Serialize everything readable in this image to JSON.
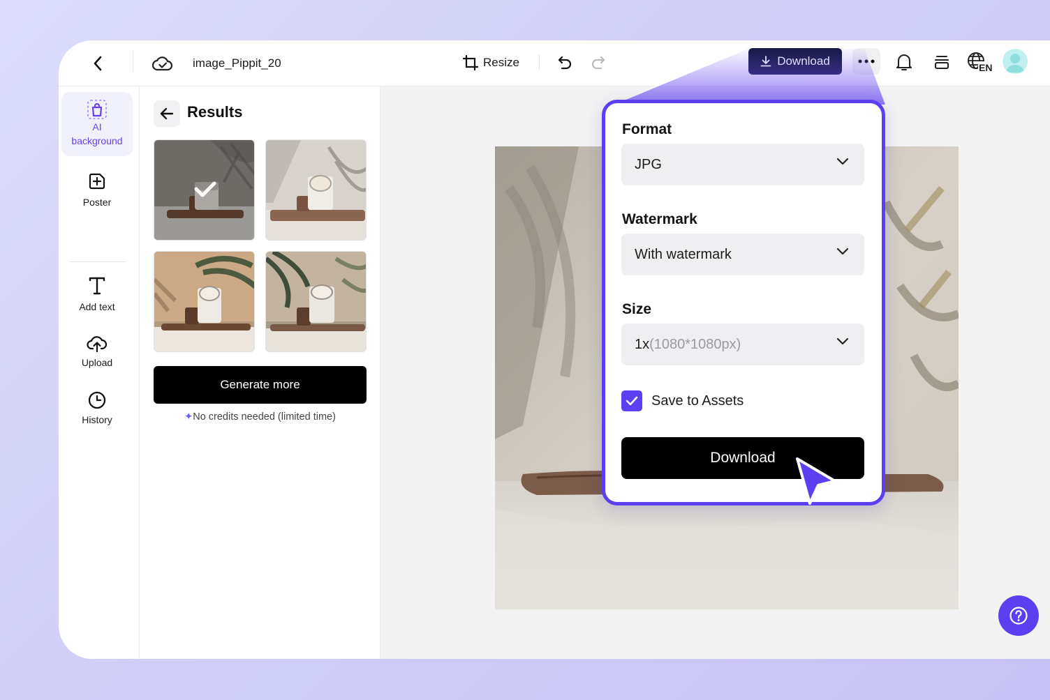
{
  "topbar": {
    "filename": "image_Pippit_20",
    "resize_label": "Resize",
    "download_label": "Download",
    "lang_code": "EN"
  },
  "rail": {
    "items": [
      {
        "label": "AI background",
        "icon": "ai-bag-icon",
        "active": true
      },
      {
        "label": "Poster",
        "icon": "poster-icon"
      },
      {
        "label": "Add text",
        "icon": "text-icon"
      },
      {
        "label": "Upload",
        "icon": "upload-cloud-icon"
      },
      {
        "label": "History",
        "icon": "clock-icon"
      }
    ]
  },
  "results": {
    "title": "Results",
    "generate_label": "Generate more",
    "credits_note": "No credits needed (limited time)"
  },
  "download_popover": {
    "format_label": "Format",
    "format_value": "JPG",
    "watermark_label": "Watermark",
    "watermark_value": "With watermark",
    "size_label": "Size",
    "size_value_main": "1x",
    "size_value_detail": "(1080*1080px)",
    "save_assets_label": "Save to Assets",
    "save_assets_checked": true,
    "download_button": "Download"
  },
  "colors": {
    "accent": "#5b3ff0",
    "dark_button": "#131640",
    "rail_active": "#6a3ff0"
  }
}
